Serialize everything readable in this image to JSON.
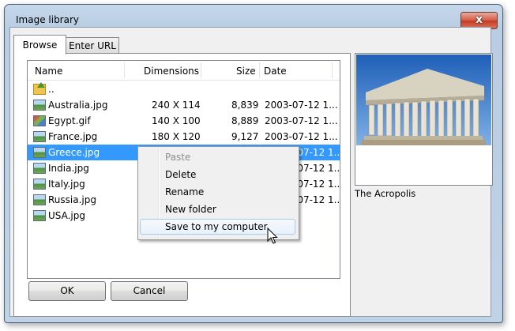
{
  "window": {
    "title": "Image library",
    "close_glyph": "x"
  },
  "tabs": [
    {
      "label": "Browse",
      "active": true
    },
    {
      "label": "Enter URL",
      "active": false
    }
  ],
  "columns": {
    "name": "Name",
    "dimensions": "Dimensions",
    "size": "Size",
    "date": "Date"
  },
  "files": [
    {
      "name": "..",
      "dimensions": "",
      "size": "",
      "date": "",
      "icon": "folder-up-icon"
    },
    {
      "name": "Australia.jpg",
      "dimensions": "240 X 114",
      "size": "8,839",
      "date": "2003-07-12 1...",
      "icon": "image-file-icon"
    },
    {
      "name": "Egypt.gif",
      "dimensions": "140 X 100",
      "size": "8,889",
      "date": "2003-07-12 1...",
      "icon": "gif-file-icon"
    },
    {
      "name": "France.jpg",
      "dimensions": "180 X 120",
      "size": "9,127",
      "date": "2003-07-12 1...",
      "icon": "image-file-icon"
    },
    {
      "name": "Greece.jpg",
      "dimensions": "",
      "size": "",
      "date": "-07-12 1...",
      "icon": "image-file-icon",
      "selected": true
    },
    {
      "name": "India.jpg",
      "dimensions": "",
      "size": "",
      "date": "-07-12 1...",
      "icon": "image-file-icon"
    },
    {
      "name": "Italy.jpg",
      "dimensions": "",
      "size": "",
      "date": "-07-12 1...",
      "icon": "image-file-icon"
    },
    {
      "name": "Russia.jpg",
      "dimensions": "",
      "size": "",
      "date": "-07-12 1...",
      "icon": "image-file-icon"
    },
    {
      "name": "USA.jpg",
      "dimensions": "",
      "size": "",
      "date": "",
      "icon": "image-file-icon"
    }
  ],
  "context_menu": [
    {
      "label": "Paste",
      "enabled": false
    },
    {
      "label": "Delete",
      "enabled": true
    },
    {
      "label": "Rename",
      "enabled": true
    },
    {
      "label": "New folder",
      "enabled": true
    },
    {
      "label": "Save to my computer",
      "enabled": true,
      "highlighted": true
    }
  ],
  "preview": {
    "caption": "The Acropolis",
    "image": "acropolis-photo"
  },
  "buttons": {
    "ok": "OK",
    "cancel": "Cancel"
  },
  "colors": {
    "selection": "#3399ff",
    "window_frame": "#bfd2e6",
    "close_button": "#c8442a"
  }
}
